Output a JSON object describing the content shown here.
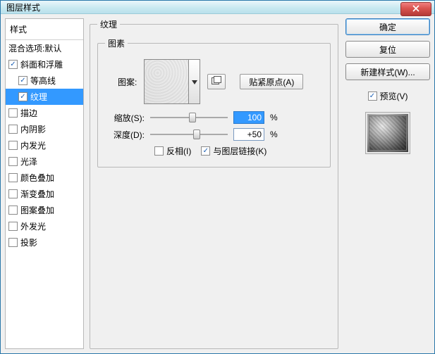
{
  "window": {
    "title": "图层样式"
  },
  "styles": {
    "header": "样式",
    "blending": "混合选项:默认",
    "items": [
      {
        "label": "斜面和浮雕",
        "checked": true,
        "selected": false,
        "indent": false
      },
      {
        "label": "等高线",
        "checked": true,
        "selected": false,
        "indent": true
      },
      {
        "label": "纹理",
        "checked": true,
        "selected": true,
        "indent": true
      },
      {
        "label": "描边",
        "checked": false,
        "selected": false,
        "indent": false
      },
      {
        "label": "内阴影",
        "checked": false,
        "selected": false,
        "indent": false
      },
      {
        "label": "内发光",
        "checked": false,
        "selected": false,
        "indent": false
      },
      {
        "label": "光泽",
        "checked": false,
        "selected": false,
        "indent": false
      },
      {
        "label": "颜色叠加",
        "checked": false,
        "selected": false,
        "indent": false
      },
      {
        "label": "渐变叠加",
        "checked": false,
        "selected": false,
        "indent": false
      },
      {
        "label": "图案叠加",
        "checked": false,
        "selected": false,
        "indent": false
      },
      {
        "label": "外发光",
        "checked": false,
        "selected": false,
        "indent": false
      },
      {
        "label": "投影",
        "checked": false,
        "selected": false,
        "indent": false
      }
    ]
  },
  "settings": {
    "outer_title": "纹理",
    "inner_title": "图素",
    "pattern_label": "图案:",
    "snap_label": "贴紧原点(A)",
    "scale": {
      "label": "缩放(S):",
      "value": "100",
      "unit": "%",
      "thumb_pct": 50
    },
    "depth": {
      "label": "深度(D):",
      "value": "+50",
      "unit": "%",
      "thumb_pct": 55
    },
    "invert": {
      "label": "反相(I)",
      "checked": false
    },
    "link": {
      "label": "与图层链接(K)",
      "checked": true
    }
  },
  "right": {
    "ok": "确定",
    "reset": "复位",
    "newstyle": "新建样式(W)...",
    "preview": {
      "label": "预览(V)",
      "checked": true
    }
  }
}
